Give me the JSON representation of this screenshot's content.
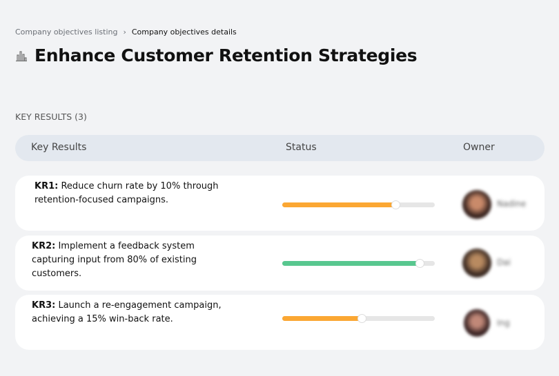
{
  "breadcrumb": {
    "items": [
      "Company objectives listing",
      "Company objectives details"
    ]
  },
  "page": {
    "title": "Enhance Customer Retention Strategies",
    "icon": "building-chart-icon"
  },
  "section": {
    "label": "KEY RESULTS (3)"
  },
  "table": {
    "headers": [
      "Key Results",
      "Status",
      "Owner"
    ],
    "rows": [
      {
        "code": "KR1:",
        "text": "Reduce churn rate by 10% through retention-focused campaigns.",
        "progress": 0.74,
        "color": "#fba733",
        "owner": "Nadine"
      },
      {
        "code": "KR2:",
        "text": "Implement a feedback system capturing input from 80% of existing customers.",
        "progress": 0.9,
        "color": "#58c78f",
        "owner": "Dai"
      },
      {
        "code": "KR3:",
        "text": "Launch a re-engagement campaign, achieving a 15% win-back rate.",
        "progress": 0.52,
        "color": "#fba733",
        "owner": "Ing"
      }
    ]
  }
}
